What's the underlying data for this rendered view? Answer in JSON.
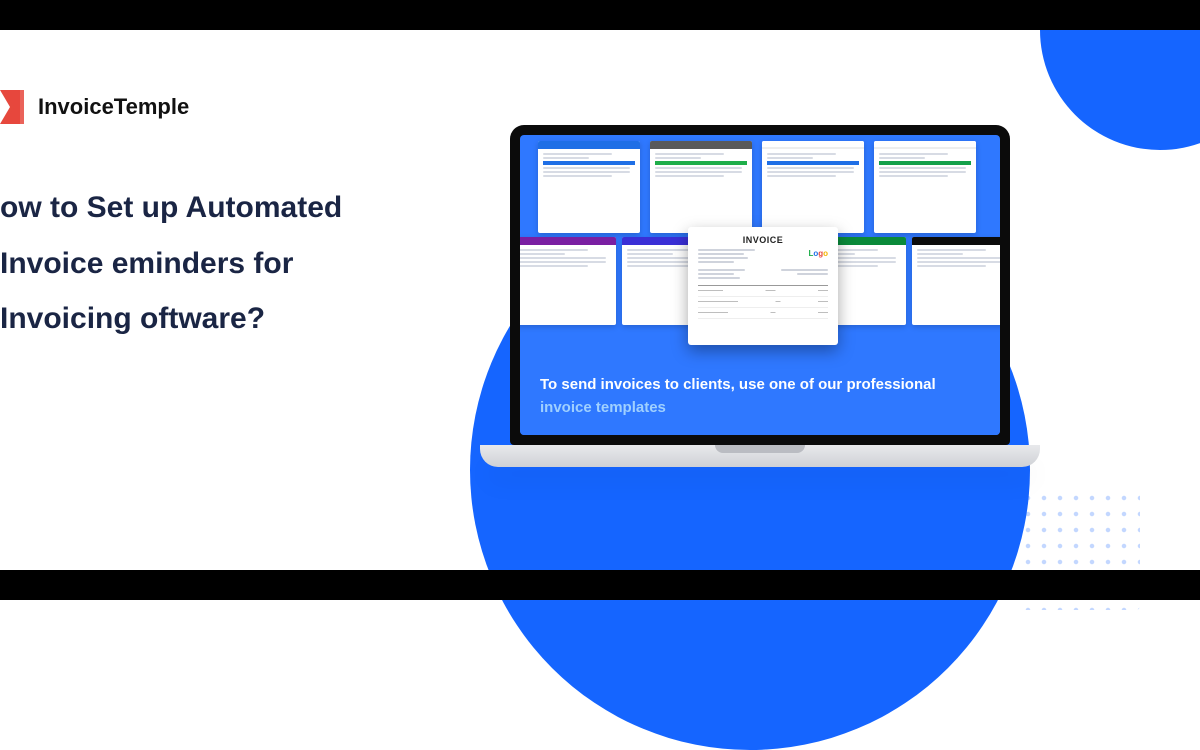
{
  "brand": {
    "name": "InvoiceTemple"
  },
  "headline": "ow to Set up Automated Invoice eminders for Invoicing oftware?",
  "laptop": {
    "caption_lead": "To send invoices to clients, use one of our professional",
    "caption_link": "invoice templates",
    "center_invoice": {
      "title": "INVOICE",
      "logo_text": "Logo"
    }
  },
  "accent_color": "#1565ff"
}
